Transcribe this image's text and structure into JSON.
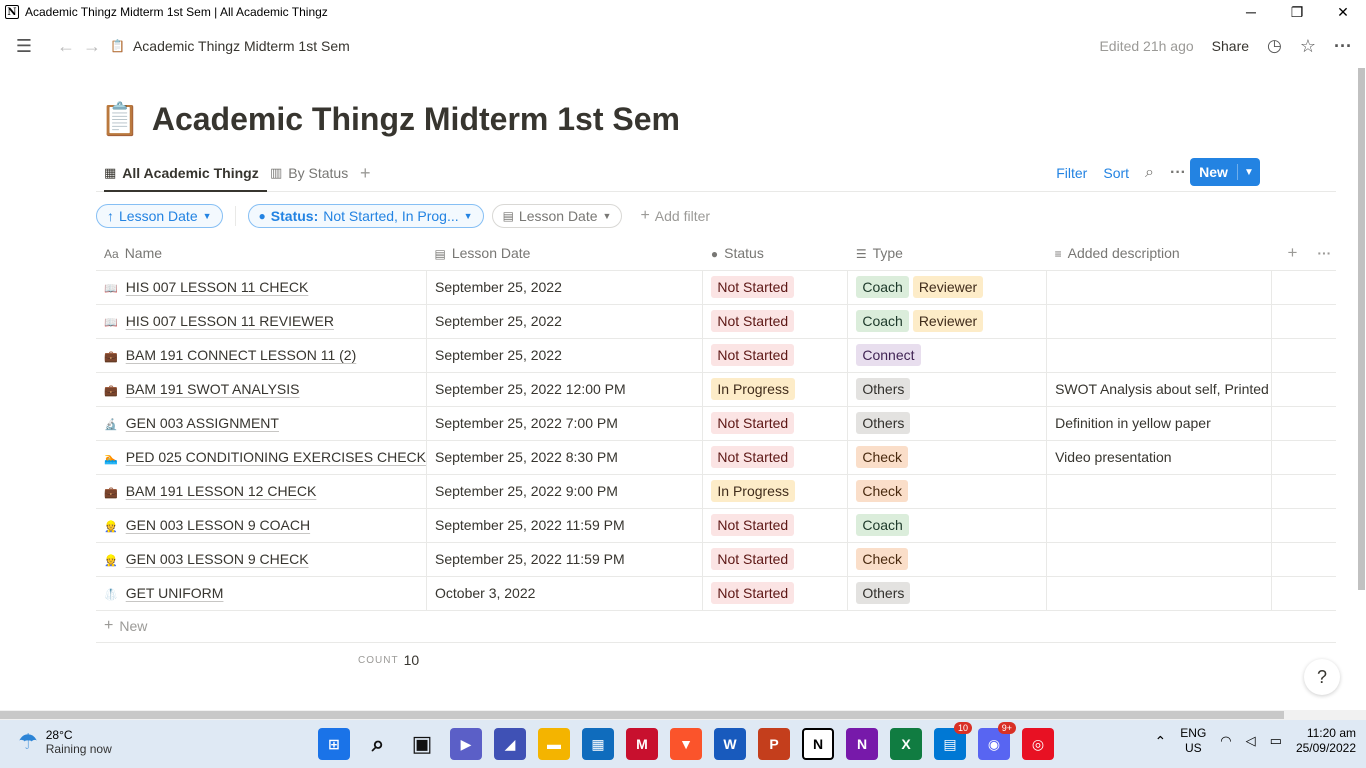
{
  "window": {
    "title": "Academic Thingz Midterm 1st Sem | All Academic Thingz",
    "minimize": "─",
    "maximize": "❐",
    "close": "✕"
  },
  "topbar": {
    "breadcrumb": "Academic Thingz Midterm 1st Sem",
    "edited": "Edited 21h ago",
    "share": "Share"
  },
  "page": {
    "title_emoji": "📋",
    "title": "Academic Thingz Midterm 1st Sem"
  },
  "views": {
    "tabs": [
      {
        "label": "All Academic Thingz",
        "active": true
      },
      {
        "label": "By Status",
        "active": false
      }
    ],
    "filter": "Filter",
    "sort": "Sort",
    "new": "New"
  },
  "filterbar": {
    "sort_pill": "Lesson Date",
    "status_pill_key": "Status:",
    "status_pill_value": "Not Started, In Prog...",
    "date_pill": "Lesson Date",
    "add_filter": "Add filter"
  },
  "table": {
    "headers": [
      "Name",
      "Lesson Date",
      "Status",
      "Type",
      "Added description"
    ],
    "rows": [
      {
        "emoji": "📖",
        "name": "HIS 007 LESSON 11 CHECK",
        "date": "September 25, 2022",
        "status": "Not Started",
        "types": [
          "Coach",
          "Reviewer"
        ],
        "desc": ""
      },
      {
        "emoji": "📖",
        "name": "HIS 007 LESSON 11 REVIEWER",
        "date": "September 25, 2022",
        "status": "Not Started",
        "types": [
          "Coach",
          "Reviewer"
        ],
        "desc": ""
      },
      {
        "emoji": "💼",
        "name": "BAM 191 CONNECT LESSON 11 (2)",
        "date": "September 25, 2022",
        "status": "Not Started",
        "types": [
          "Connect"
        ],
        "desc": ""
      },
      {
        "emoji": "💼",
        "name": "BAM 191 SWOT ANALYSIS",
        "date": "September 25, 2022 12:00 PM",
        "status": "In Progress",
        "types": [
          "Others"
        ],
        "desc": "SWOT Analysis about self, Printed"
      },
      {
        "emoji": "🔬",
        "name": "GEN 003 ASSIGNMENT",
        "date": "September 25, 2022 7:00 PM",
        "status": "Not Started",
        "types": [
          "Others"
        ],
        "desc": "Definition in yellow paper"
      },
      {
        "emoji": "🏊",
        "name": "PED 025 CONDITIONING EXERCISES CHECK",
        "date": "September 25, 2022 8:30 PM",
        "status": "Not Started",
        "types": [
          "Check"
        ],
        "desc": "Video presentation"
      },
      {
        "emoji": "💼",
        "name": "BAM 191 LESSON 12 CHECK",
        "date": "September 25, 2022 9:00 PM",
        "status": "In Progress",
        "types": [
          "Check"
        ],
        "desc": ""
      },
      {
        "emoji": "👷",
        "name": "GEN 003 LESSON 9 COACH",
        "date": "September 25, 2022 11:59 PM",
        "status": "Not Started",
        "types": [
          "Coach"
        ],
        "desc": ""
      },
      {
        "emoji": "👷",
        "name": "GEN 003 LESSON 9 CHECK",
        "date": "September 25, 2022 11:59 PM",
        "status": "Not Started",
        "types": [
          "Check"
        ],
        "desc": ""
      },
      {
        "emoji": "🥼",
        "name": "GET UNIFORM",
        "date": "October 3, 2022",
        "status": "Not Started",
        "types": [
          "Others"
        ],
        "desc": ""
      }
    ],
    "new_row": "New",
    "count_label": "COUNT",
    "count_value": "10"
  },
  "tag_colors": {
    "Not Started": {
      "bg": "#fbe4e4",
      "fg": "#5d1715"
    },
    "In Progress": {
      "bg": "#fdecc8",
      "fg": "#402c1b"
    },
    "Coach": {
      "bg": "#dbeddb",
      "fg": "#1c3829"
    },
    "Reviewer": {
      "bg": "#fdecc8",
      "fg": "#402c1b"
    },
    "Connect": {
      "bg": "#e8deee",
      "fg": "#412454"
    },
    "Others": {
      "bg": "#e3e2e0",
      "fg": "#32302c"
    },
    "Check": {
      "bg": "#fadec9",
      "fg": "#49290e"
    }
  },
  "help": "?",
  "taskbar": {
    "temp": "28°C",
    "weather": "Raining now",
    "lang1": "ENG",
    "lang2": "US",
    "time": "11:20 am",
    "date": "25/09/2022",
    "apps": [
      {
        "icon": "windows-start-icon",
        "glyph": "⊞",
        "bg": "#1a73e8"
      },
      {
        "icon": "search-icon",
        "glyph": "⌕",
        "bg": "transparent"
      },
      {
        "icon": "task-view-icon",
        "glyph": "▣",
        "bg": "transparent"
      },
      {
        "icon": "chat-icon",
        "glyph": "▶",
        "bg": "#5b5fc7"
      },
      {
        "icon": "vscode-icon",
        "glyph": "◢",
        "bg": "#3f51b5"
      },
      {
        "icon": "file-explorer-icon",
        "glyph": "▬",
        "bg": "#f4b400"
      },
      {
        "icon": "store-icon",
        "glyph": "▦",
        "bg": "#0f6cbd"
      },
      {
        "icon": "mcafee-icon",
        "glyph": "M",
        "bg": "#c8102e"
      },
      {
        "icon": "brave-icon",
        "glyph": "▼",
        "bg": "#fb542b"
      },
      {
        "icon": "word-icon",
        "glyph": "W",
        "bg": "#185abd"
      },
      {
        "icon": "powerpoint-icon",
        "glyph": "P",
        "bg": "#c43e1c"
      },
      {
        "icon": "notion-icon",
        "glyph": "N",
        "bg": "#ffffff"
      },
      {
        "icon": "onenote-icon",
        "glyph": "N",
        "bg": "#7719aa"
      },
      {
        "icon": "excel-icon",
        "glyph": "X",
        "bg": "#107c41"
      },
      {
        "icon": "messaging-icon",
        "glyph": "▤",
        "bg": "#0078d4",
        "badge": "10"
      },
      {
        "icon": "discord-icon",
        "glyph": "◉",
        "bg": "#5865f2",
        "badge": "9+"
      },
      {
        "icon": "recorder-icon",
        "glyph": "◎",
        "bg": "#e81123"
      }
    ]
  }
}
